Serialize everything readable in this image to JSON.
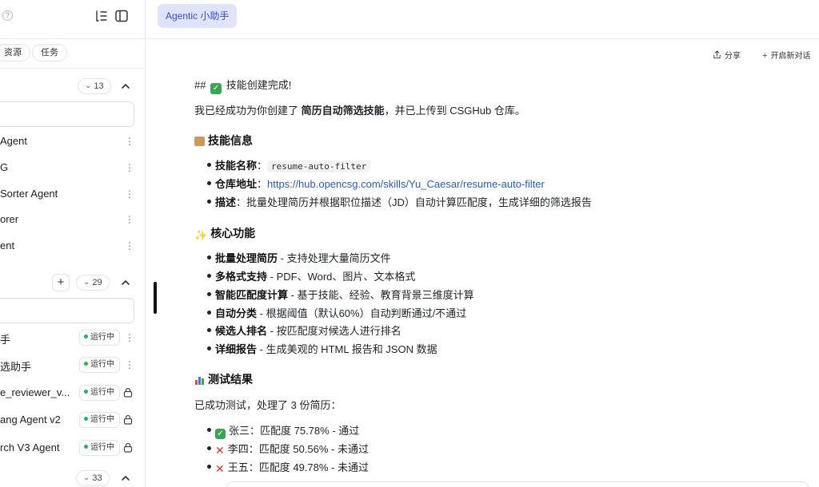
{
  "sidebar": {
    "chips": [
      "资源",
      "任务"
    ],
    "group1": {
      "count": "13"
    },
    "group1_items": [
      "Agent",
      "G",
      "Sorter Agent",
      "orer",
      "ent"
    ],
    "group2": {
      "count": "29"
    },
    "group2_items": [
      {
        "label": "手",
        "status": "运行中",
        "action": "more"
      },
      {
        "label": "选助手",
        "status": "运行中",
        "action": "more"
      },
      {
        "label": "e_reviewer_v...",
        "status": "运行中",
        "action": "lock"
      },
      {
        "label": "ang Agent v2",
        "status": "运行中",
        "action": "lock"
      },
      {
        "label": "rch V3 Agent",
        "status": "运行中",
        "action": "lock"
      }
    ],
    "group3": {
      "count": "33"
    }
  },
  "header": {
    "agent_tab": "Agentic 小助手",
    "share": "分享",
    "new_chat": "开启新对话"
  },
  "message": {
    "heading_prefix": "##",
    "heading_text": "技能创建完成!",
    "intro_pre": "我已经成功为你创建了 ",
    "intro_bold": "简历自动筛选技能",
    "intro_post": "，并已上传到 CSGHub 仓库。",
    "info_title": "技能信息",
    "info": {
      "name_label": "技能名称",
      "name_value": "resume-auto-filter",
      "repo_label": "仓库地址",
      "repo_value": "https://hub.opencsg.com/skills/Yu_Caesar/resume-auto-filter",
      "desc_label": "描述",
      "desc_value": "：批量处理简历并根据职位描述（JD）自动计算匹配度，生成详细的筛选报告"
    },
    "features_title": "核心功能",
    "features": [
      {
        "bold": "批量处理简历",
        "text": " - 支持处理大量简历文件"
      },
      {
        "bold": "多格式支持",
        "text": " - PDF、Word、图片、文本格式"
      },
      {
        "bold": "智能匹配度计算",
        "text": " - 基于技能、经验、教育背景三维度计算"
      },
      {
        "bold": "自动分类",
        "text": " - 根据阈值（默认60%）自动判断通过/不通过"
      },
      {
        "bold": "候选人排名",
        "text": " - 按匹配度对候选人进行排名"
      },
      {
        "bold": "详细报告",
        "text": " - 生成美观的 HTML 报告和 JSON 数据"
      }
    ],
    "results_title": "测试结果",
    "results_intro": "已成功测试，处理了 3 份简历：",
    "results": [
      {
        "mark": "pass",
        "text": "张三：匹配度 75.78% - 通过"
      },
      {
        "mark": "fail",
        "text": "李四：匹配度 50.56% - 未通过"
      },
      {
        "mark": "fail",
        "text": "王五：匹配度 49.78% - 未通过"
      }
    ]
  },
  "colors": {
    "accent": "#3b4bd8",
    "tab_bg": "#dfe3fb",
    "link": "#2a59d6",
    "running_dot": "#22b35b",
    "fail": "#e0332f",
    "pass": "#3aa655"
  }
}
